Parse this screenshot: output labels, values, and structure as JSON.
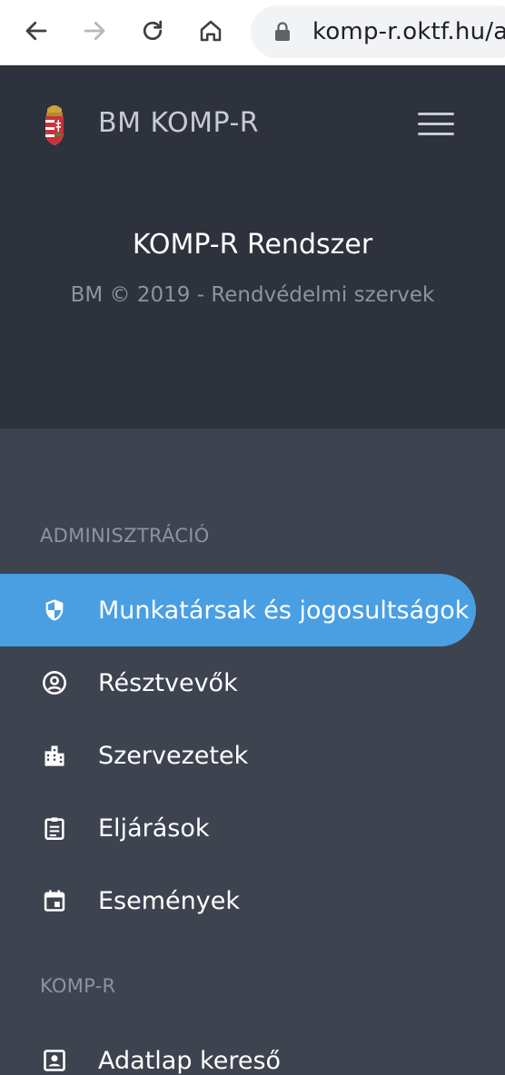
{
  "browser": {
    "url": "komp-r.oktf.hu/a"
  },
  "header": {
    "brand": "BM KOMP-R",
    "system_title": "KOMP-R Rendszer",
    "subtitle": "BM © 2019 - Rendvédelmi szervek"
  },
  "nav": {
    "sections": [
      {
        "title": "ADMINISZTRÁCIÓ",
        "items": [
          {
            "label": "Munkatársak és jogosultságok",
            "icon": "shield-icon",
            "active": true
          },
          {
            "label": "Résztvevők",
            "icon": "person-circle-icon",
            "active": false
          },
          {
            "label": "Szervezetek",
            "icon": "building-icon",
            "active": false
          },
          {
            "label": "Eljárások",
            "icon": "clipboard-icon",
            "active": false
          },
          {
            "label": "Események",
            "icon": "calendar-icon",
            "active": false
          }
        ]
      },
      {
        "title": "KOMP-R",
        "items": [
          {
            "label": "Adatlap kereső",
            "icon": "id-card-icon",
            "active": false
          }
        ]
      }
    ]
  },
  "colors": {
    "accent": "#4a9fe3",
    "header_bg": "#2e323d",
    "nav_bg": "#3e4350"
  }
}
